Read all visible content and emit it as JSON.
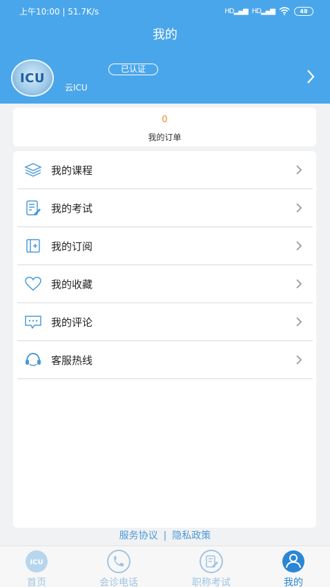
{
  "status_bar": {
    "left_text": "上午10:00 | 51.7K/s",
    "signal_1": "HD",
    "signal_2": "HD",
    "battery": "48"
  },
  "header": {
    "title": "我的",
    "avatar_text": "ICU",
    "verified_badge": "已认证",
    "username": "云ICU"
  },
  "orders": {
    "count": "0",
    "label": "我的订单"
  },
  "menu": [
    {
      "label": "我的课程",
      "icon": "layers-icon"
    },
    {
      "label": "我的考试",
      "icon": "exam-edit-icon"
    },
    {
      "label": "我的订阅",
      "icon": "subscribe-book-icon"
    },
    {
      "label": "我的收藏",
      "icon": "heart-icon"
    },
    {
      "label": "我的评论",
      "icon": "comment-bubble-icon"
    },
    {
      "label": "客服热线",
      "icon": "headset-icon"
    }
  ],
  "footer": {
    "service_agreement": "服务协议",
    "separator": "|",
    "privacy_policy": "隐私政策"
  },
  "tabbar": [
    {
      "label": "首页",
      "icon": "home-icu-icon",
      "active": false
    },
    {
      "label": "会诊电话",
      "icon": "phone-icon",
      "active": false
    },
    {
      "label": "职称考试",
      "icon": "exam-icon",
      "active": false
    },
    {
      "label": "我的",
      "icon": "user-icon",
      "active": true
    }
  ],
  "colors": {
    "header_bg": "#4aa6ea",
    "accent": "#2b86d6",
    "order_count": "#e98a23"
  }
}
